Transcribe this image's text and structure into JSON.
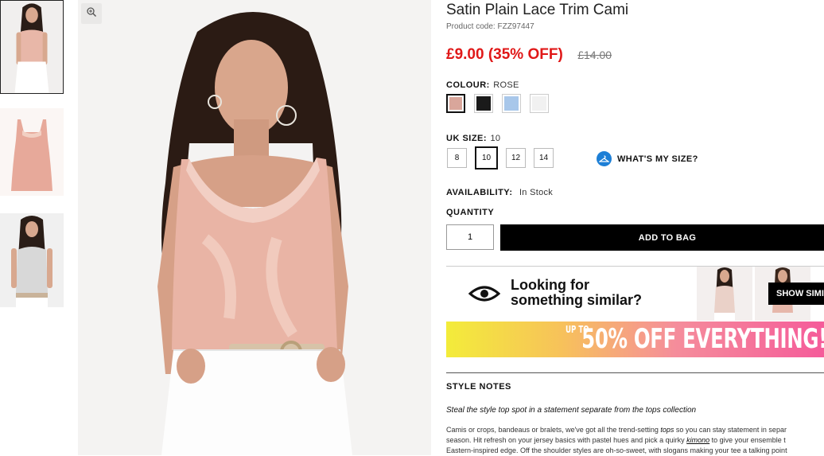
{
  "product": {
    "title": "Satin Plain Lace Trim Cami",
    "code_label": "Product code:",
    "code": "FZZ97447",
    "price_now": "£9.00 (35% OFF)",
    "price_was": "£14.00"
  },
  "colour": {
    "label": "COLOUR:",
    "selected": "ROSE",
    "swatches": [
      {
        "name": "rose",
        "color": "#d9a69b",
        "selected": true
      },
      {
        "name": "black",
        "color": "#1a1a1a",
        "selected": false
      },
      {
        "name": "blue",
        "color": "#a8c7ea",
        "selected": false
      },
      {
        "name": "white",
        "color": "#f1f1f1",
        "selected": false
      }
    ]
  },
  "size": {
    "label": "UK SIZE:",
    "selected": "10",
    "options": [
      "8",
      "10",
      "12",
      "14"
    ],
    "guide_label": "WHAT'S MY SIZE?"
  },
  "availability": {
    "label": "AVAILABILITY:",
    "value": "In Stock"
  },
  "quantity": {
    "label": "QUANTITY",
    "value": "1"
  },
  "add_to_bag": "ADD TO BAG",
  "similar": {
    "line1": "Looking for",
    "line2": "something similar?",
    "button": "SHOW SIMI"
  },
  "promo": {
    "prefix": "UP TO",
    "text": "50% OFF EVERYTHING!"
  },
  "style_notes": {
    "heading": "STYLE NOTES",
    "tagline": "Steal the style top spot in a statement separate from the tops collection",
    "line1_a": "Camis or crops, bandeaus or bralets, we've got all the trend-setting ",
    "line1_link": "tops",
    "line1_b": " so you can stay statement in separ",
    "line2_a": "season. Hit refresh on your jersey basics with pastel hues and pick a quirky ",
    "line2_link": "kimono",
    "line2_b": " to give your ensemble t",
    "line3": "Eastern-inspired edge. Off the shoulder styles are oh-so-sweet, with slogans making your tee a talking point"
  },
  "icons": {
    "zoom": "zoom-icon",
    "hanger": "hanger-icon",
    "eye": "eye-icon"
  },
  "colors": {
    "sale_red": "#e01818",
    "size_guide_blue": "#1d7fd6",
    "button_black": "#000000"
  }
}
